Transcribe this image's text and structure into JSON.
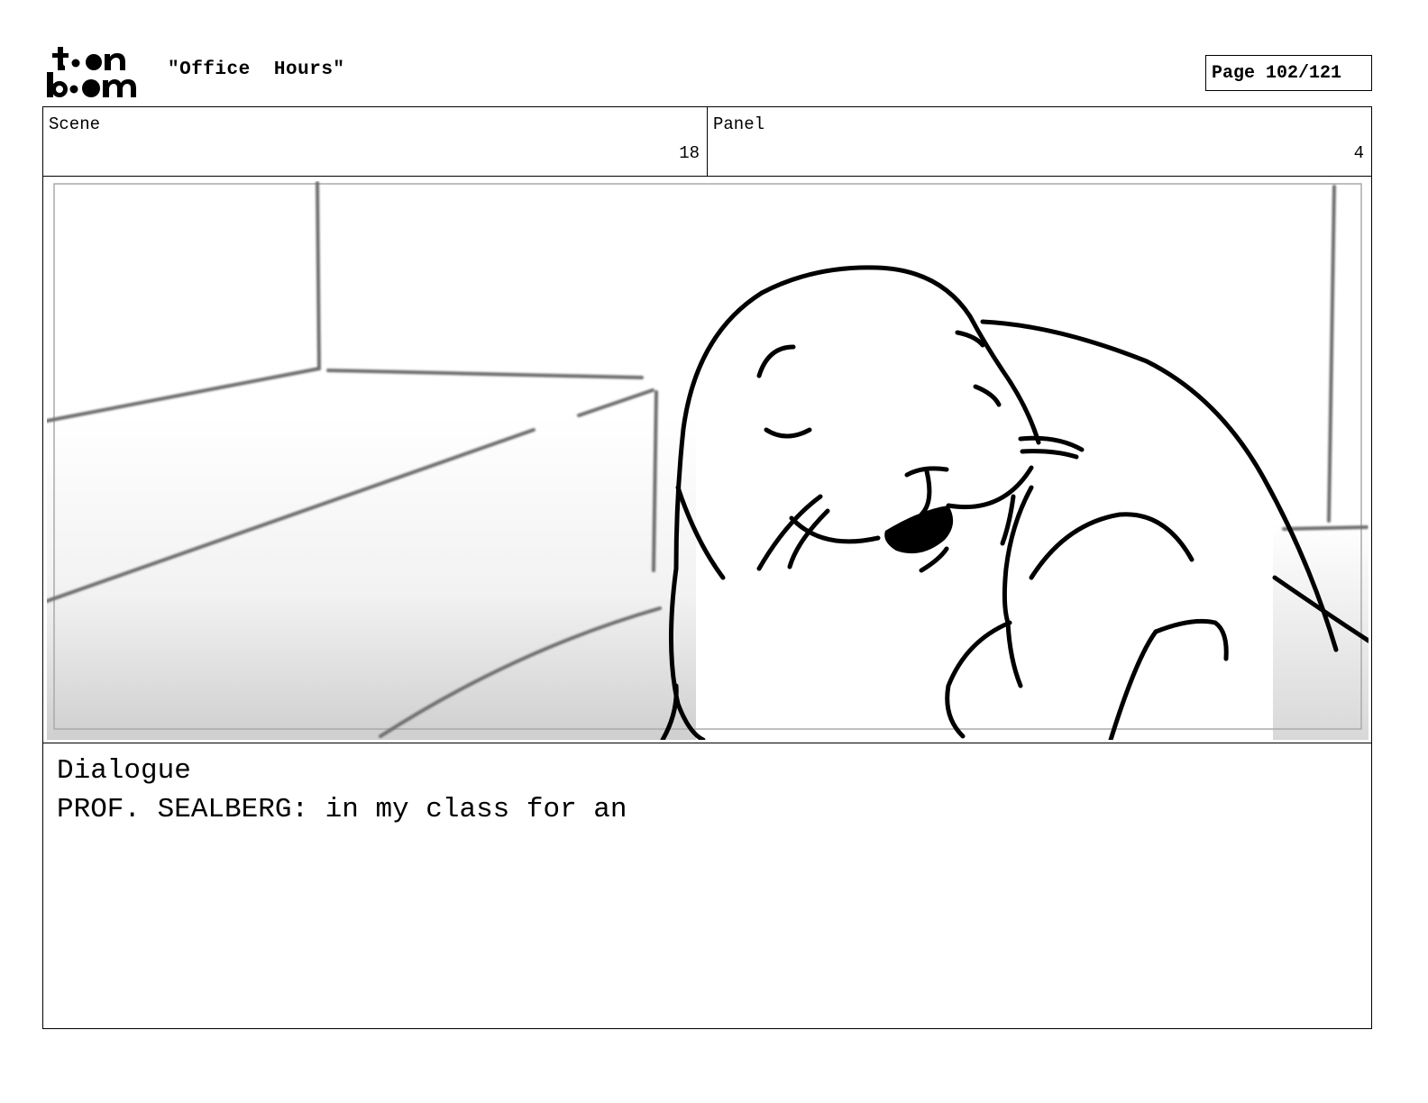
{
  "brand": {
    "logo_text": "toon boom"
  },
  "header": {
    "title": "\"Office  Hours\"",
    "page_indicator": "Page 102/121"
  },
  "scene": {
    "label": "Scene",
    "value": "18"
  },
  "panel": {
    "label": "Panel",
    "value": "4"
  },
  "dialogue": {
    "heading": "Dialogue",
    "text": "PROF. SEALBERG: in my class for an"
  }
}
